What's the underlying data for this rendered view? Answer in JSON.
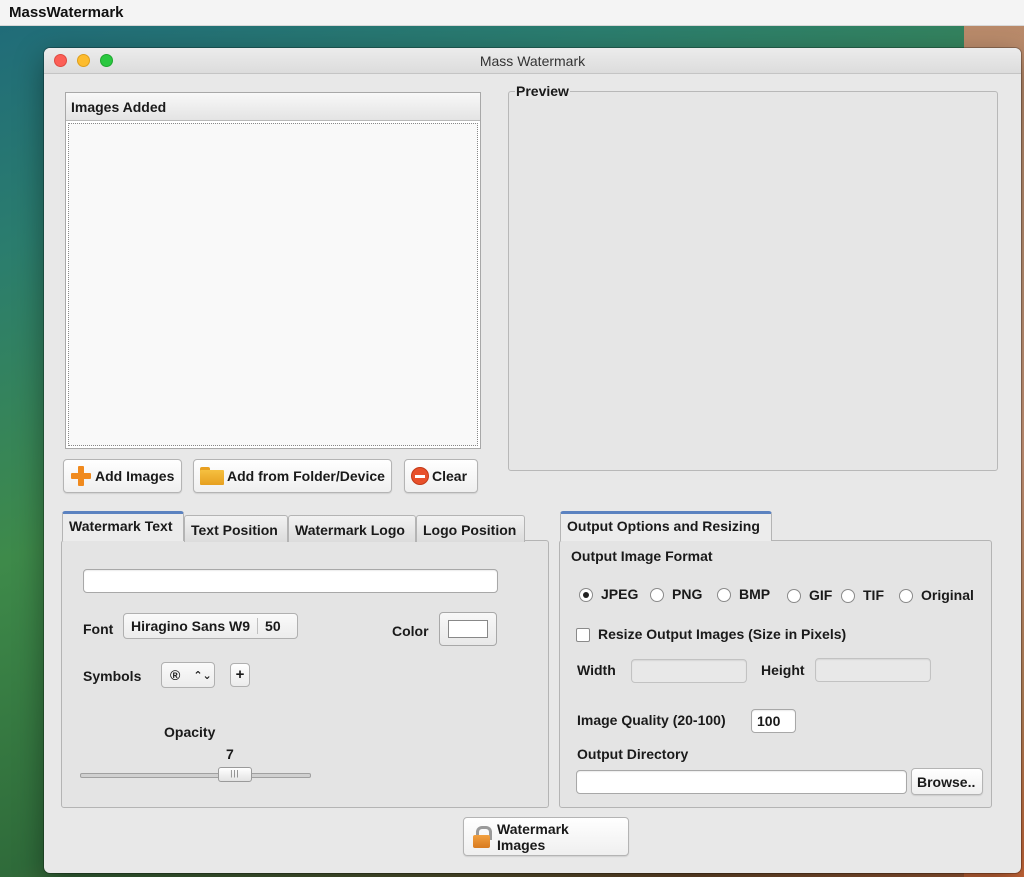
{
  "menubar": {
    "app_name": "MassWatermark"
  },
  "window": {
    "title": "Mass Watermark"
  },
  "images_list": {
    "header": "Images Added"
  },
  "preview": {
    "legend": "Preview"
  },
  "buttons": {
    "add_images": "Add Images",
    "add_folder": "Add from Folder/Device",
    "clear": "Clear",
    "watermark_images": "Watermark Images",
    "browse": "Browse.."
  },
  "watermark_tabs": [
    {
      "label": "Watermark Text",
      "active": true
    },
    {
      "label": "Text Position",
      "active": false
    },
    {
      "label": "Watermark Logo",
      "active": false
    },
    {
      "label": "Logo Position",
      "active": false
    }
  ],
  "watermark_text": {
    "text_value": "",
    "font_label": "Font",
    "font_name": "Hiragino Sans W9",
    "font_size": "50",
    "color_label": "Color",
    "color_value": "#ffffff",
    "symbols_label": "Symbols",
    "symbol_selected": "®",
    "symbol_add": "+",
    "opacity_label": "Opacity",
    "opacity_value": "7",
    "opacity_fraction": 0.7
  },
  "output": {
    "tab_label": "Output Options and Resizing",
    "format_label": "Output Image Format",
    "formats": [
      {
        "label": "JPEG",
        "checked": true
      },
      {
        "label": "PNG",
        "checked": false
      },
      {
        "label": "BMP",
        "checked": false
      },
      {
        "label": "GIF",
        "checked": false
      },
      {
        "label": "TIF",
        "checked": false
      },
      {
        "label": "Original",
        "checked": false
      }
    ],
    "resize_label": "Resize Output Images (Size in Pixels)",
    "resize_checked": false,
    "width_label": "Width",
    "width_value": "",
    "height_label": "Height",
    "height_value": "",
    "quality_label": "Image Quality (20-100)",
    "quality_value": "100",
    "directory_label": "Output Directory",
    "directory_value": ""
  },
  "colors": {
    "accent_tab": "#5b82c0",
    "add_icon": "#f08a1e",
    "clear_icon": "#e8502a"
  }
}
